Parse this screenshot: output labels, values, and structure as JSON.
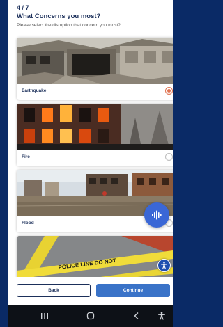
{
  "header": {
    "step": "4 / 7",
    "title": "What Concerns you most?",
    "subtitle": "Please select the disruption that concern you most?"
  },
  "options": [
    {
      "label": "Earthquake",
      "selected": true
    },
    {
      "label": "Fire",
      "selected": false
    },
    {
      "label": "Flood",
      "selected": false
    },
    {
      "label": "",
      "selected": false
    }
  ],
  "footer": {
    "back_label": "Back",
    "continue_label": "Continue"
  },
  "icons": {
    "voice": "audio-waveform-icon",
    "accessibility": "accessibility-icon",
    "nav_recent": "recent-apps-icon",
    "nav_home": "home-icon",
    "nav_back": "back-icon",
    "nav_accessibility": "accessibility-icon"
  },
  "colors": {
    "title": "#1b2f5a",
    "selected": "#e07350",
    "primary": "#3a73c8",
    "fab": "#3a67d6",
    "page_background": "#0a2a66"
  }
}
